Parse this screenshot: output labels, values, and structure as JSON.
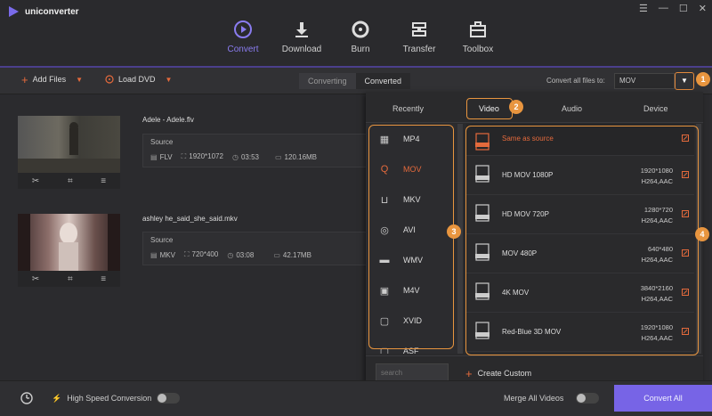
{
  "app": {
    "name": "uniconverter",
    "accent": "#7a6bea",
    "highlight": "#e8953f"
  },
  "window": {
    "controls": [
      "☰",
      "—",
      "☐",
      "✕"
    ]
  },
  "nav": [
    {
      "label": "Convert",
      "icon": "convert-icon",
      "active": true
    },
    {
      "label": "Download",
      "icon": "download-icon"
    },
    {
      "label": "Burn",
      "icon": "burn-icon"
    },
    {
      "label": "Transfer",
      "icon": "transfer-icon"
    },
    {
      "label": "Toolbox",
      "icon": "toolbox-icon"
    }
  ],
  "toolbar": {
    "add_files": "Add Files",
    "load_dvd": "Load DVD",
    "tab_converting": "Converting",
    "tab_converted": "Converted",
    "convert_all_label": "Convert all files to:",
    "target_format": "MOV"
  },
  "files": [
    {
      "name": "Adele - Adele.flv",
      "source_label": "Source",
      "format": "FLV",
      "resolution": "1920*1072",
      "duration": "03:53",
      "size": "120.16MB"
    },
    {
      "name": "ashley he_said_she_said.mkv",
      "source_label": "Source",
      "format": "MKV",
      "resolution": "720*400",
      "duration": "03:08",
      "size": "42.17MB"
    }
  ],
  "panel": {
    "tabs": [
      "Recently",
      "Video",
      "Audio",
      "Device"
    ],
    "active_tab": "Video",
    "formats": [
      {
        "label": "MP4",
        "icon": "mp4-film-icon"
      },
      {
        "label": "MOV",
        "icon": "mov-quicktime-icon",
        "active": true
      },
      {
        "label": "MKV",
        "icon": "mkv-icon"
      },
      {
        "label": "AVI",
        "icon": "avi-play-icon"
      },
      {
        "label": "WMV",
        "icon": "wmv-clapper-icon"
      },
      {
        "label": "M4V",
        "icon": "m4v-icon"
      },
      {
        "label": "XVID",
        "icon": "xvid-icon"
      },
      {
        "label": "ASF",
        "icon": "asf-icon"
      }
    ],
    "presets": [
      {
        "name": "Same as source",
        "badge": "SOURCE",
        "res": "",
        "codec": ""
      },
      {
        "name": "HD MOV 1080P",
        "badge": "1080P",
        "res": "1920*1080",
        "codec": "H264,AAC"
      },
      {
        "name": "HD MOV 720P",
        "badge": "720P",
        "res": "1280*720",
        "codec": "H264,AAC"
      },
      {
        "name": "MOV 480P",
        "badge": "480P",
        "res": "640*480",
        "codec": "H264,AAC"
      },
      {
        "name": "4K MOV",
        "badge": "4K",
        "res": "3840*2160",
        "codec": "H264,AAC"
      },
      {
        "name": "Red-Blue 3D MOV",
        "badge": "3D RB",
        "res": "1920*1080",
        "codec": "H264,AAC"
      }
    ],
    "search_placeholder": "search",
    "create_custom": "Create Custom"
  },
  "callouts": [
    "1",
    "2",
    "3",
    "4"
  ],
  "bottom": {
    "high_speed": "High Speed Conversion",
    "merge": "Merge All Videos",
    "convert_all": "Convert All"
  }
}
